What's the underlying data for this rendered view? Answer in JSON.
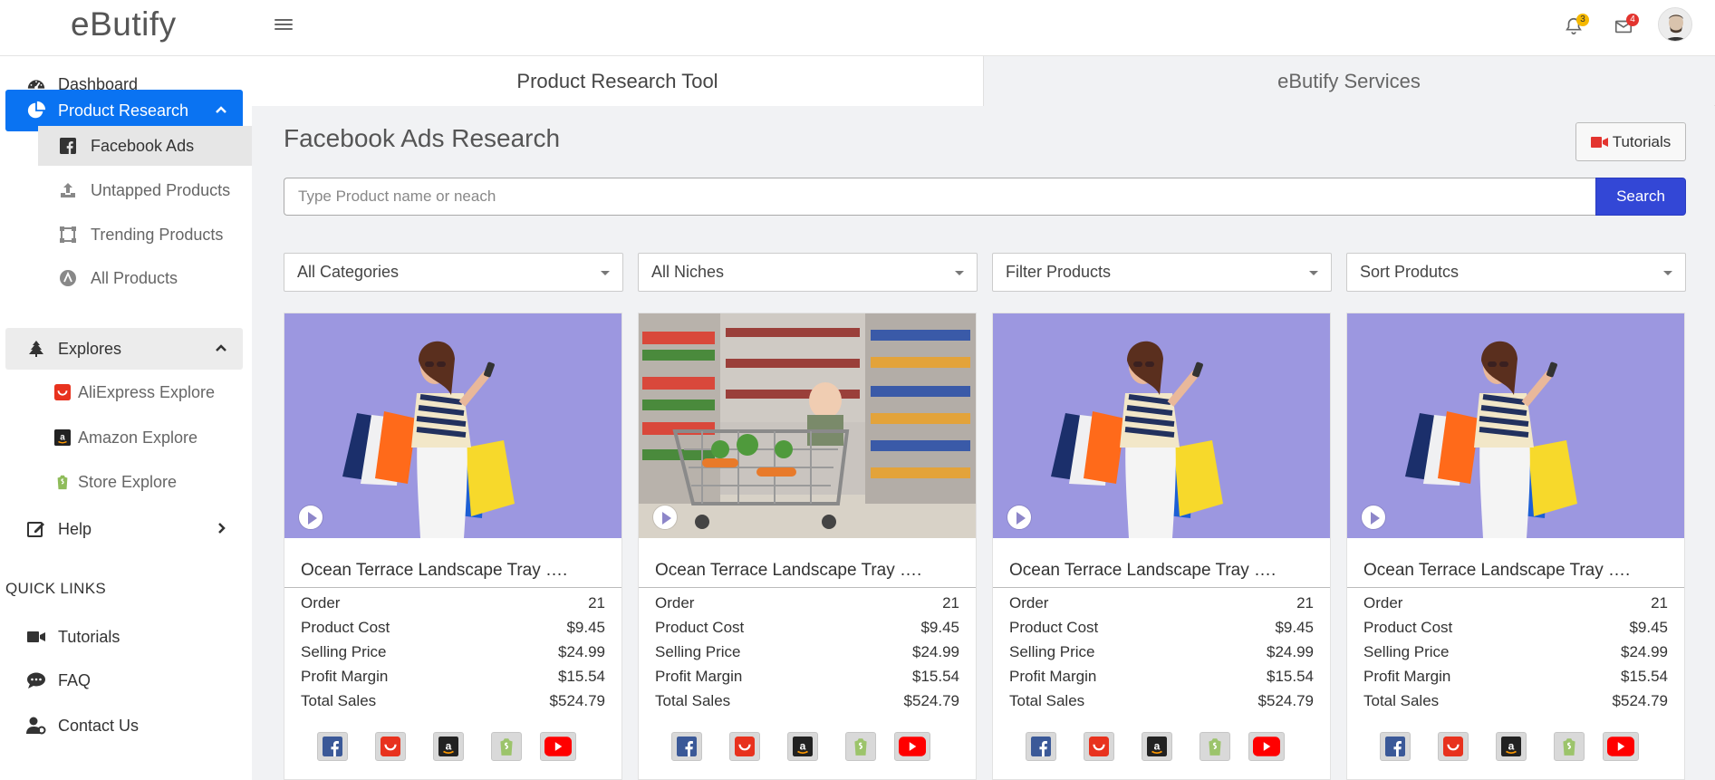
{
  "brand": "eButify",
  "header": {
    "notifications_count": "3",
    "messages_count": "4"
  },
  "sidebar": {
    "dashboard": "Dashboard",
    "product_research": "Product Research",
    "product_research_items": [
      "Facebook Ads",
      "Untapped Products",
      "Trending Products",
      "All Products"
    ],
    "explores": "Explores",
    "explores_items": [
      "AliExpress Explore",
      "Amazon Explore",
      "Store Explore"
    ],
    "help": "Help",
    "quick_links_title": "QUICK LINKS",
    "quick_links": [
      "Tutorials",
      "FAQ",
      "Contact Us"
    ]
  },
  "tabs": [
    "Product Research Tool",
    "eButify Services"
  ],
  "page": {
    "title": "Facebook Ads Research",
    "tutorials_label": "Tutorials",
    "search_placeholder": "Type Product name or neach",
    "search_button": "Search"
  },
  "filters": [
    "All Categories",
    "All Niches",
    "Filter Products",
    "Sort Produtcs"
  ],
  "cards": [
    {
      "title": "Ocean Terrace Landscape Tray ….",
      "image": "shopping-woman",
      "stats": [
        [
          "Order",
          "21"
        ],
        [
          "Product Cost",
          "$9.45"
        ],
        [
          "Selling Price",
          "$24.99"
        ],
        [
          "Profit Margin",
          "$15.54"
        ],
        [
          "Total Sales",
          "$524.79"
        ]
      ]
    },
    {
      "title": "Ocean Terrace Landscape Tray ….",
      "image": "supermarket-cart",
      "stats": [
        [
          "Order",
          "21"
        ],
        [
          "Product Cost",
          "$9.45"
        ],
        [
          "Selling Price",
          "$24.99"
        ],
        [
          "Profit Margin",
          "$15.54"
        ],
        [
          "Total Sales",
          "$524.79"
        ]
      ]
    },
    {
      "title": "Ocean Terrace Landscape Tray ….",
      "image": "shopping-woman",
      "stats": [
        [
          "Order",
          "21"
        ],
        [
          "Product Cost",
          "$9.45"
        ],
        [
          "Selling Price",
          "$24.99"
        ],
        [
          "Profit Margin",
          "$15.54"
        ],
        [
          "Total Sales",
          "$524.79"
        ]
      ]
    },
    {
      "title": "Ocean Terrace Landscape Tray ….",
      "image": "shopping-woman",
      "stats": [
        [
          "Order",
          "21"
        ],
        [
          "Product Cost",
          "$9.45"
        ],
        [
          "Selling Price",
          "$24.99"
        ],
        [
          "Profit Margin",
          "$15.54"
        ],
        [
          "Total Sales",
          "$524.79"
        ]
      ]
    }
  ],
  "shop_icons": [
    "facebook-icon",
    "aliexpress-icon",
    "amazon-icon",
    "shopify-icon",
    "youtube-icon"
  ],
  "colors": {
    "primary": "#0a73f2",
    "search_button": "#3347d6",
    "image_bg": "#9c97e0"
  }
}
